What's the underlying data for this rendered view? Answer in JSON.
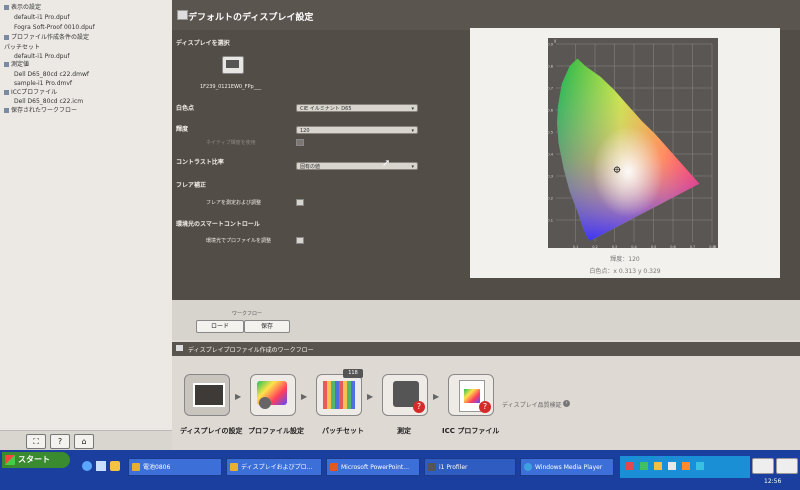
{
  "tree": {
    "items": [
      {
        "label": "表示の設定",
        "indent": 0
      },
      {
        "label": "default-i1 Pro.dpuf",
        "indent": 1
      },
      {
        "label": "Fogra Soft-Proof 0010.dpuf",
        "indent": 1
      },
      {
        "label": "プロファイル作成条件の設定",
        "indent": 0
      },
      {
        "label": "パッチセット",
        "indent": 0
      },
      {
        "label": "default-i1 Pro.dpuf",
        "indent": 1
      },
      {
        "label": "測定値",
        "indent": 0
      },
      {
        "label": "Dell D65_80cd c22.dmwf",
        "indent": 1
      },
      {
        "label": "sample-i1 Pro.dmvf",
        "indent": 1
      },
      {
        "label": "ICCプロファイル",
        "indent": 0
      },
      {
        "label": "Dell D65_80cd c22.icm",
        "indent": 1
      },
      {
        "label": "保存されたワークフロー",
        "indent": 0
      }
    ],
    "bottom_buttons": [
      "⛶",
      "?",
      "⌂"
    ]
  },
  "main": {
    "title": "デフォルトのディスプレイ設定",
    "select_display_label": "ディスプレイを選択",
    "display_name": "1F239_0121EW0_FPp___",
    "white_point_label": "白色点",
    "white_point_value": "CIE イルミナント D65",
    "luminance_label": "輝度",
    "luminance_value": "120",
    "luminance_check_label": "ネイティブ輝度を使用",
    "contrast_label": "コントラスト比率",
    "contrast_value": "固有の値",
    "flare_label": "フレア補正",
    "flare_check_label": "フレアを測定および調整",
    "smart_label": "環境光のスマートコントロール",
    "smart_check_label": "環境光でプロファイルを調整"
  },
  "chart_panel": {
    "luminance_text": "輝度：120",
    "whitepoint_text": "白色点：x 0.313  y 0.329"
  },
  "chart_data": {
    "type": "scatter",
    "title": "",
    "xlabel": "x",
    "ylabel": "y",
    "xlim": [
      0,
      0.8
    ],
    "ylim": [
      0,
      0.9
    ],
    "x_ticks": [
      "0.1",
      "0.2",
      "0.3",
      "0.4",
      "0.5",
      "0.6",
      "0.7",
      "0.8"
    ],
    "y_ticks": [
      "0.1",
      "0.2",
      "0.3",
      "0.4",
      "0.5",
      "0.6",
      "0.7",
      "0.8",
      "0.9"
    ],
    "grid": true,
    "series": [
      {
        "x": [
          0.313
        ],
        "y": [
          0.329
        ]
      }
    ]
  },
  "buttons": {
    "group_label": "ワークフロー",
    "load_label": "ロード",
    "save_label": "保存"
  },
  "workflow": {
    "title": "ディスプレイプロファイル作成のワークフロー",
    "steps": [
      {
        "label": "ディスプレイの設定"
      },
      {
        "label": "プロファイル設定"
      },
      {
        "label": "パッチセット"
      },
      {
        "label": "測定"
      },
      {
        "label": "ICC プロファイル"
      }
    ],
    "badge": "118",
    "extra_label": "ディスプレイ品質検証"
  },
  "taskbar": {
    "start_label": "スタート",
    "tasks": [
      {
        "label": "電池0806"
      },
      {
        "label": "ディスプレイおよびプロ..."
      },
      {
        "label": "Microsoft PowerPoint..."
      },
      {
        "label": "i1 Profiler"
      },
      {
        "label": "Windows Media Player"
      }
    ],
    "clock": "12:56"
  },
  "colors": {
    "main_bg": "#534d47",
    "tree_bg": "#ece9e4",
    "taskbar": "#1b3f9f",
    "start": "#3a8a30"
  }
}
